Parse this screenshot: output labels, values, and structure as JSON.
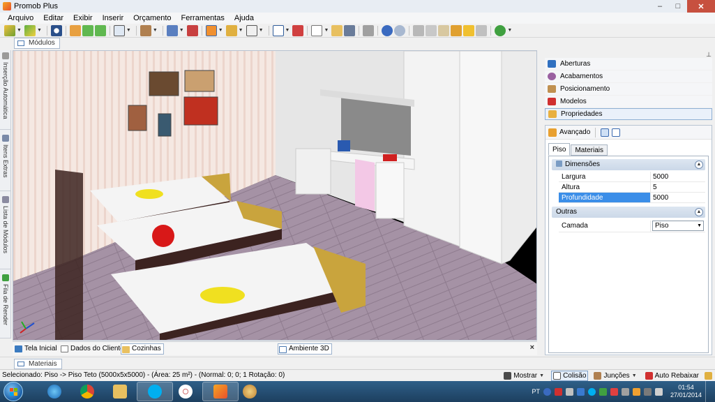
{
  "window": {
    "title": "Promob Plus"
  },
  "menu": [
    "Arquivo",
    "Editar",
    "Exibir",
    "Inserir",
    "Orçamento",
    "Ferramentas",
    "Ajuda"
  ],
  "doc_tab": {
    "label": "Módulos"
  },
  "left_rail": [
    "Inserção Automática",
    "Itens Extras",
    "Lista de Módulos",
    "Fila de Render"
  ],
  "bottom_tabs": {
    "tela_inicial": "Tela Inicial",
    "dados_cliente": "Dados do Cliente",
    "cozinhas": "Cozinhas",
    "ambiente": "Ambiente 3D",
    "close": "×"
  },
  "materiais_tab": "Materiais",
  "status": {
    "text": "Selecionado: Piso -> Piso Teto (5000x5x5000) - (Área: 25 m²) - (Normal: 0; 0; 1 Rotação: 0)",
    "mostrar": "Mostrar",
    "colisao": "Colisão",
    "juncoes": "Junções",
    "auto_rebaixar": "Auto Rebaixar"
  },
  "right_panel": {
    "pin": "⊥",
    "items": [
      "Aberturas",
      "Acabamentos",
      "Posicionamento",
      "Modelos",
      "Propriedades"
    ],
    "avancado": "Avançado",
    "tabs": [
      "Piso",
      "Materiais"
    ],
    "groups": {
      "dimensoes": {
        "title": "Dimensões",
        "rows": [
          {
            "key": "Largura",
            "value": "5000"
          },
          {
            "key": "Altura",
            "value": "5"
          },
          {
            "key": "Profundidade",
            "value": "5000"
          }
        ]
      },
      "outras": {
        "title": "Outras",
        "rows": [
          {
            "key": "Camada",
            "value": "Piso"
          }
        ]
      }
    }
  },
  "taskbar": {
    "lang": "PT",
    "time": "01:54",
    "date": "27/01/2014"
  },
  "colors": {
    "wall": "#f3e3dc",
    "floor": "#9f8c9f",
    "cabinet": "#eeeeee",
    "bed_wood": "#3c2320",
    "bench": "#c9a43d",
    "accent_blue": "#3b8ee8"
  }
}
